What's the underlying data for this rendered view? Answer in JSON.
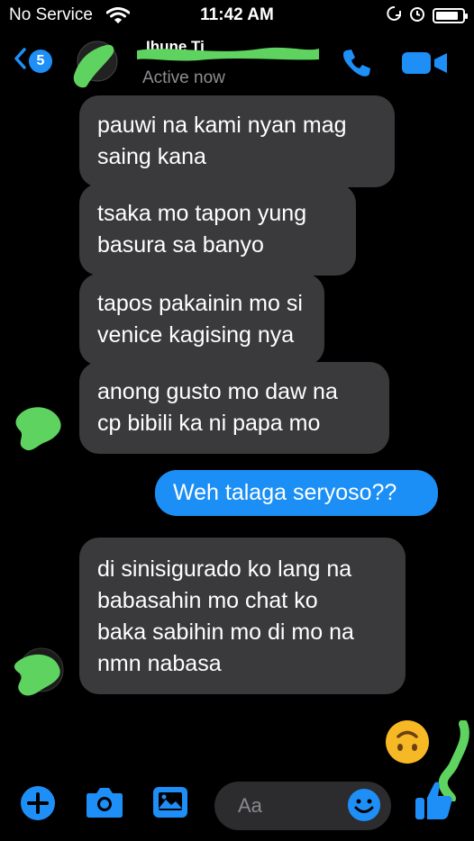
{
  "status_bar": {
    "carrier": "No Service",
    "time": "11:42 AM",
    "battery_level": 0.85,
    "icons": [
      "wifi-icon",
      "orientation-lock-icon",
      "alarm-icon",
      "battery-icon"
    ]
  },
  "header": {
    "back_badge": "5",
    "contact_name": "",
    "status": "Active now",
    "icons": [
      "back-chevron-icon",
      "phone-icon",
      "video-camera-icon"
    ]
  },
  "messages": [
    {
      "sender": "contact",
      "lines": [
        "pauwi na kami nyan mag",
        "saing kana"
      ]
    },
    {
      "sender": "contact",
      "lines": [
        "tsaka mo tapon yung",
        "basura sa banyo"
      ]
    },
    {
      "sender": "contact",
      "lines": [
        "tapos pakainin mo si",
        "venice kagising nya"
      ]
    },
    {
      "sender": "contact",
      "lines": [
        "anong gusto mo daw na",
        "cp bibili ka ni papa mo"
      ]
    },
    {
      "sender": "me",
      "lines": [
        "Weh talaga seryoso??"
      ]
    },
    {
      "sender": "contact",
      "lines": [
        "di sinisigurado ko lang na",
        "babasahin mo chat ko",
        "baka sabihin mo di mo na",
        "nmn nabasa"
      ]
    }
  ],
  "reaction_emoji": "upside-down-face",
  "composer": {
    "placeholder": "Aa",
    "icons": [
      "plus-icon",
      "camera-icon",
      "gallery-icon",
      "emoji-icon",
      "thumbs-up-icon"
    ]
  },
  "colors": {
    "background": "#000000",
    "incoming_bubble": "#3a3a3c",
    "outgoing_bubble": "#1b8ff5",
    "accent": "#1e8ff7",
    "redaction_green": "#5fd35f"
  }
}
